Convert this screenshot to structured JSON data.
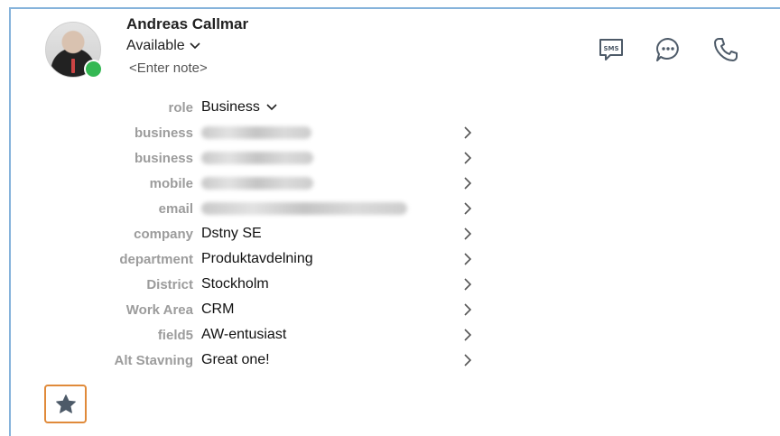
{
  "contact": {
    "name": "Andreas Callmar",
    "status": "Available",
    "note_placeholder": "<Enter note>"
  },
  "role": {
    "label": "role",
    "value": "Business"
  },
  "fields": [
    {
      "label": "business",
      "value": "",
      "redacted": true,
      "blur_width": "122px"
    },
    {
      "label": "business",
      "value": "",
      "redacted": true,
      "blur_width": "124px"
    },
    {
      "label": "mobile",
      "value": "",
      "redacted": true,
      "blur_width": "124px"
    },
    {
      "label": "email",
      "value": "",
      "redacted": true,
      "blur_width": "228px"
    },
    {
      "label": "company",
      "value": "Dstny SE"
    },
    {
      "label": "department",
      "value": "Produktavdelning"
    },
    {
      "label": "District",
      "value": "Stockholm"
    },
    {
      "label": "Work Area",
      "value": "CRM"
    },
    {
      "label": "field5",
      "value": "AW-entusiast"
    },
    {
      "label": "Alt Stavning",
      "value": "Great one!"
    }
  ],
  "icons": {
    "sms": "sms-icon",
    "chat": "chat-bubble-icon",
    "phone": "phone-icon",
    "favorite": "star-icon",
    "chevron": "chevron-right-icon"
  },
  "colors": {
    "presence": "#34b853",
    "label": "#9c9c9c",
    "favorite_border": "#e08a3a",
    "star": "#4d5a68",
    "icon": "#4d5a68",
    "frame": "#86b3db"
  }
}
